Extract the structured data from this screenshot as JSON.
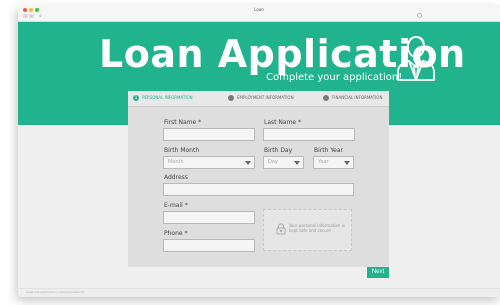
{
  "window": {
    "title": "Loan",
    "search_glyph": "⌕",
    "back_glyph": "‹",
    "forward_glyph": "›"
  },
  "hero": {
    "title": "Loan Application",
    "subtitle": "Complete your application!",
    "icon": "businessman-avatar-icon",
    "background": "#20b38e"
  },
  "steps": [
    {
      "number": "1",
      "label": "PERSONAL INFORMATION",
      "active": true
    },
    {
      "number": "2",
      "label": "EMPLOYMENT INFORMATION",
      "active": false
    },
    {
      "number": "3",
      "label": "FINANCIAL INFORMATION",
      "active": false
    }
  ],
  "form": {
    "first_name_label": "First Name *",
    "first_name_value": "",
    "last_name_label": "Last Name *",
    "last_name_value": "",
    "birth_month_label": "Birth Month",
    "birth_month_value": "Month",
    "birth_day_label": "Birth Day",
    "birth_day_value": "Day",
    "birth_year_label": "Birth Year",
    "birth_year_value": "Year",
    "address_label": "Address",
    "address_value": "",
    "email_label": "E-mail *",
    "email_value": "",
    "phone_label": "Phone *",
    "phone_value": "",
    "privacy_text": "Your personal information is kept safe and secure",
    "next_label": "Next"
  },
  "status": {
    "text": "www.loanapplication.com/personal-info"
  },
  "colors": {
    "accent": "#20b38e",
    "card": "#dedede",
    "page": "#efefef"
  }
}
